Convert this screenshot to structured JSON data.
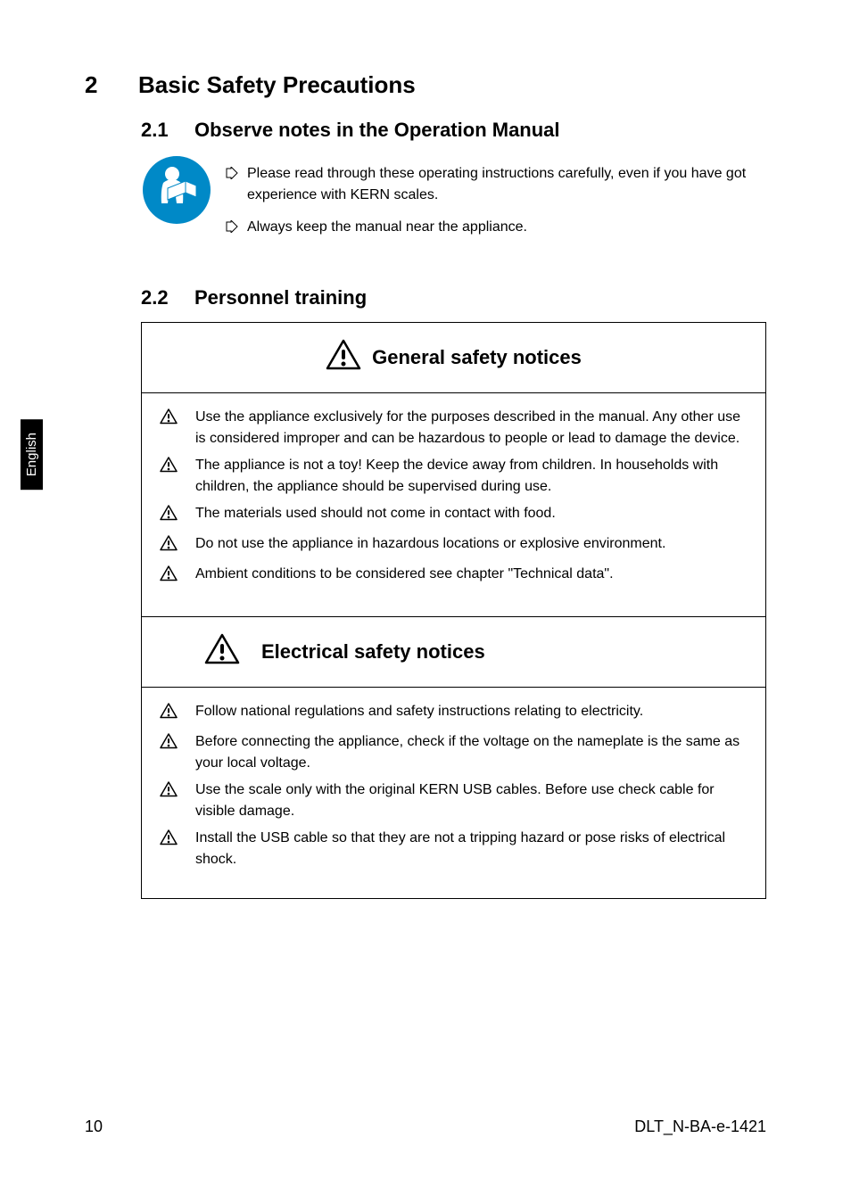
{
  "language_tab": "English",
  "section": {
    "number": "2",
    "title": "Basic Safety Precautions"
  },
  "subsection1": {
    "number": "2.1",
    "title": "Observe notes in the Operation Manual"
  },
  "intro_items": [
    "Please read through these operating instructions carefully, even if you have got experience with KERN scales.",
    "Always keep the manual near the appliance."
  ],
  "subsection2": {
    "number": "2.2",
    "title": "Personnel training"
  },
  "notice_general": {
    "title": "General safety notices",
    "items": [
      "Use the appliance exclusively for the purposes described in the manual. Any other use is considered improper and can be hazardous to people or lead to damage the device.",
      "The appliance is not a toy! Keep the device away from children. In households with children, the appliance should be supervised during use.",
      "The materials used should not come in contact with food.",
      "Do not use the appliance in hazardous locations or explosive environment.",
      "Ambient conditions to be considered see chapter \"Technical data\"."
    ]
  },
  "notice_electrical": {
    "title": "Electrical safety notices",
    "items": [
      "Follow national regulations and safety instructions relating to electricity.",
      "Before connecting the appliance, check if the voltage on the nameplate is the same as your local voltage.",
      "Use the scale only with the original KERN USB cables. Before use check cable for visible damage.",
      "Install the USB cable so that they are not a tripping hazard or pose risks of electrical shock."
    ]
  },
  "footer": {
    "page": "10",
    "doc_id": "DLT_N-BA-e-1421"
  }
}
